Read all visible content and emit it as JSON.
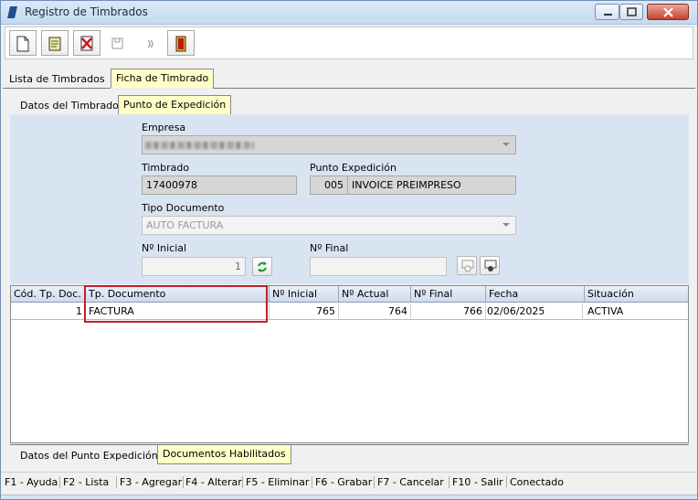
{
  "window": {
    "title": "Registro de Timbrados",
    "accent": "#1f4f8a"
  },
  "toolbar": {
    "icons": [
      "new-document-icon",
      "edit-document-icon",
      "delete-document-icon",
      "save-disk-icon",
      "cancel-arrow-icon",
      "exit-door-icon"
    ]
  },
  "main_tabs": [
    {
      "label": "Lista de Timbrados",
      "active": false
    },
    {
      "label": "Ficha de Timbrado",
      "active": true
    }
  ],
  "sub_tabs": [
    {
      "label": "Datos del Timbrado",
      "active": false
    },
    {
      "label": "Punto de Expedición",
      "active": true
    }
  ],
  "form": {
    "empresa_label": "Empresa",
    "timbrado_label": "Timbrado",
    "timbrado_value": "17400978",
    "punto_label": "Punto Expedición",
    "punto_code": "005",
    "punto_desc": "INVOICE PREIMPRESO",
    "tipo_doc_label": "Tipo Documento",
    "tipo_doc_value": "AUTO FACTURA",
    "nro_inicial_label": "Nº Inicial",
    "nro_inicial_value": "1",
    "nro_final_label": "Nº Final",
    "nro_final_value": ""
  },
  "grid": {
    "columns": [
      "Cód. Tp. Doc.",
      "Tp. Documento",
      "Nº Inicial",
      "Nº Actual",
      "Nº Final",
      "Fecha",
      "Situación"
    ],
    "rows": [
      [
        "1",
        "FACTURA",
        "765",
        "764",
        "766",
        "02/06/2025",
        "ACTIVA"
      ]
    ]
  },
  "bottom_tabs": [
    {
      "label": "Datos del Punto Expedición",
      "active": false
    },
    {
      "label": "Documentos Habilitados",
      "active": true
    }
  ],
  "statusbar": [
    "F1 - Ayuda",
    "F2 - Lista",
    "F3 - Agregar",
    "F4 - Alterar",
    "F5 - Eliminar",
    "F6 - Grabar",
    "F7 - Cancelar",
    "F10 - Salir",
    "Conectado"
  ]
}
